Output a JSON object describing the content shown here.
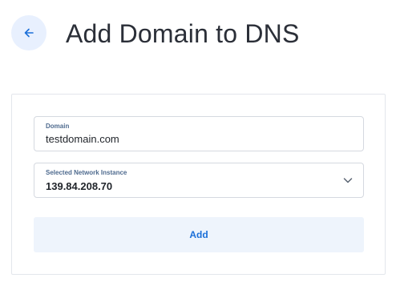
{
  "header": {
    "title": "Add Domain to DNS",
    "back_icon": "arrow-left-icon"
  },
  "form": {
    "domain": {
      "label": "Domain",
      "value": "testdomain.com"
    },
    "network_instance": {
      "label": "Selected Network Instance",
      "value": "139.84.208.70",
      "dropdown_icon": "chevron-down-icon"
    },
    "add_button_label": "Add"
  },
  "colors": {
    "accent": "#1b6fd8",
    "back_button_bg": "#e8f0fe",
    "add_button_bg": "#eef4fc"
  }
}
